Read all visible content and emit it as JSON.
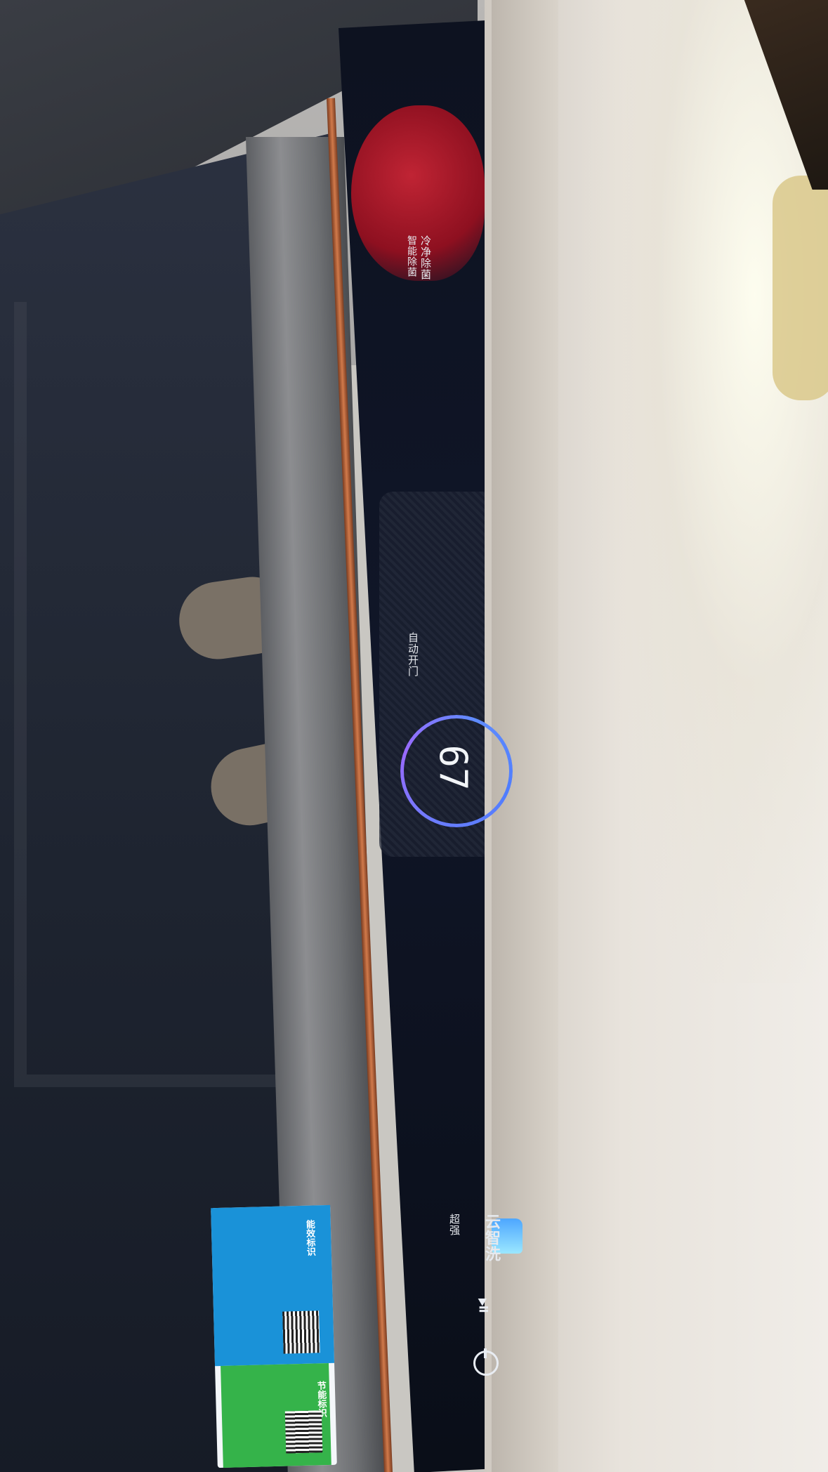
{
  "panel": {
    "label_top_1": "冷净除菌",
    "label_top_2": "智能除菌",
    "label_auto_open": "自动开门",
    "temperature_readout": "67",
    "label_mode": "云智洗",
    "label_sub": "超强"
  },
  "sticker": {
    "top_text": "能效标识",
    "bottom_text": "节能标识"
  },
  "icons": {
    "cloud": "cloud-app-icon",
    "play": "play-pause-icon",
    "power": "power-icon"
  },
  "colors": {
    "panel_bg": "#0d1220",
    "ring_accent": "#6a7dff",
    "copper": "#d17a4b",
    "counter": "#e8e3dc"
  }
}
